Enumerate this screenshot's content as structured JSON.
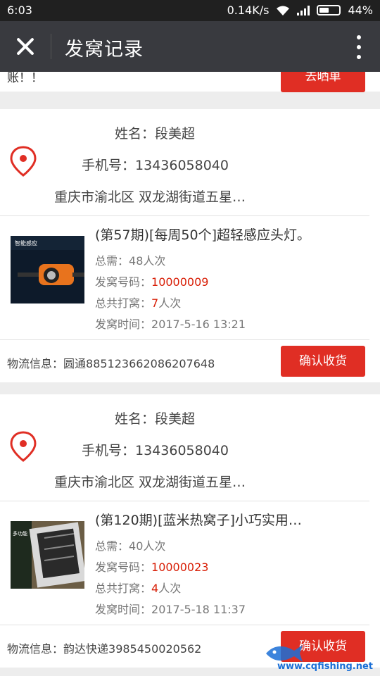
{
  "status_bar": {
    "time": "6:03",
    "network_speed": "0.14K/s",
    "battery": "44%"
  },
  "app_bar": {
    "title": "发窝记录",
    "close_icon": "close-icon",
    "more_icon": "more-vertical-icon"
  },
  "partial_card": {
    "tail_text": "账！！",
    "button_label": "去晒单"
  },
  "records": [
    {
      "name_label": "姓名：",
      "name": "段美超",
      "phone_label": "手机号：",
      "phone": "13436058040",
      "address": "重庆市渝北区 双龙湖街道五星…",
      "product_title": "(第57期)[每周50个]超轻感应头灯。",
      "total_label": "总需：",
      "total_value": "48人次",
      "code_label": "发窝号码：",
      "code_value": "10000009",
      "hits_label": "总共打窝：",
      "hits_count": "7",
      "hits_unit": "人次",
      "time_label": "发窝时间：",
      "time_value": "2017-5-16 13:21",
      "logistics_label": "物流信息：",
      "logistics_value": "圆通885123662086207648",
      "button_label": "确认收货"
    },
    {
      "name_label": "姓名：",
      "name": "段美超",
      "phone_label": "手机号：",
      "phone": "13436058040",
      "address": "重庆市渝北区 双龙湖街道五星…",
      "product_title": "(第120期)[蓝米热窝子]小巧实用…",
      "total_label": "总需：",
      "total_value": "40人次",
      "code_label": "发窝号码：",
      "code_value": "10000023",
      "hits_label": "总共打窝：",
      "hits_count": "4",
      "hits_unit": "人次",
      "time_label": "发窝时间：",
      "time_value": "2017-5-18 11:37",
      "logistics_label": "物流信息：",
      "logistics_value": "韵达快递3985450020562",
      "button_label": "确认收货"
    }
  ],
  "watermark": {
    "text": "www.cqfishing.net"
  },
  "colors": {
    "accent_red": "#e02e24",
    "highlight_red": "#d81e06",
    "appbar": "#393a3f",
    "statusbar": "#202020"
  }
}
